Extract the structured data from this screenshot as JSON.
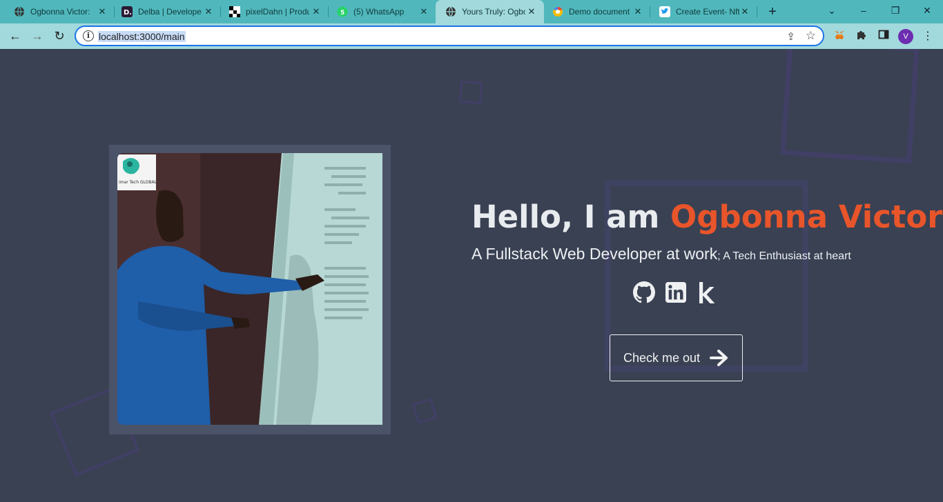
{
  "browser": {
    "tabs": [
      {
        "title": "Ogbonna Victor:",
        "icon": "globe-icon",
        "active": false
      },
      {
        "title": "Delba | Develope",
        "icon": "delba-favicon",
        "active": false
      },
      {
        "title": "pixelDahn | Produ",
        "icon": "pixeldahn-favicon",
        "active": false
      },
      {
        "title": "(5) WhatsApp",
        "icon": "whatsapp-favicon",
        "active": false
      },
      {
        "title": "Yours Truly: Ogbo",
        "icon": "globe-icon",
        "active": true
      },
      {
        "title": "Demo document",
        "icon": "google-favicon",
        "active": false
      },
      {
        "title": "Create Event- Nft",
        "icon": "twitter-favicon",
        "active": false
      }
    ],
    "url": "localhost:3000/main",
    "profile_initial": "V"
  },
  "hero": {
    "greeting": "Hello, I am ",
    "name": "Ogbonna Victor",
    "role": "A Fullstack Web Developer at work",
    "separator": ";",
    "passion": " A Tech Enthusiast at heart",
    "cta_label": "Check me out",
    "photo_watermark": "imar Tech GLOBAL"
  },
  "socials": [
    {
      "name": "GitHub",
      "icon": "github-icon"
    },
    {
      "name": "LinkedIn",
      "icon": "linkedin-icon"
    },
    {
      "name": "Kaggle",
      "icon": "kaggle-icon"
    }
  ],
  "colors": {
    "page_bg": "#394153",
    "accent": "#e8552a",
    "tabbar": "#50b8bd",
    "toolbar": "#a2d9dc"
  }
}
